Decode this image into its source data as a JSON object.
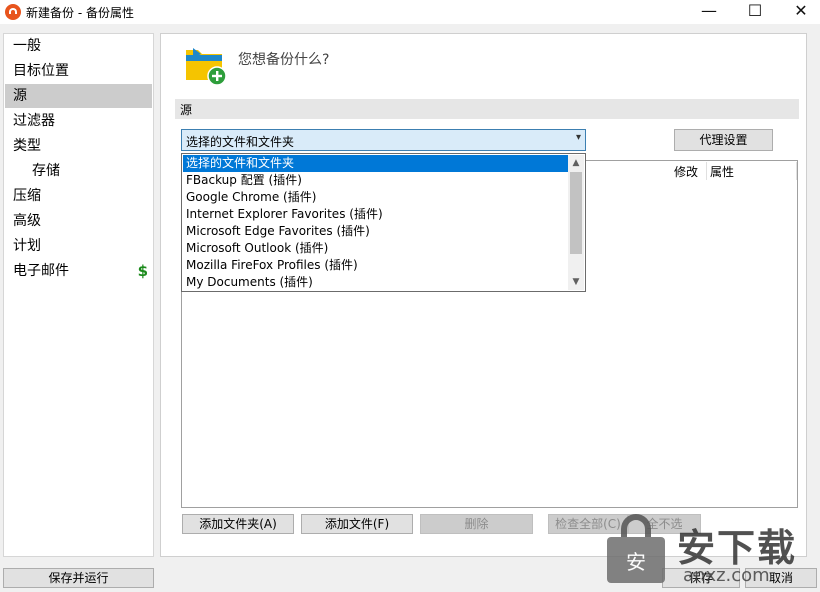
{
  "window": {
    "title": "新建备份 - 备份属性",
    "minimize_glyph": "—",
    "maximize_glyph": "☐",
    "close_glyph": "✕"
  },
  "sidebar": {
    "items": [
      {
        "label": "一般"
      },
      {
        "label": "目标位置"
      },
      {
        "label": "源",
        "selected": true
      },
      {
        "label": "过滤器"
      },
      {
        "label": "类型"
      },
      {
        "label": "存储",
        "sub": true
      },
      {
        "label": "压缩"
      },
      {
        "label": "高级"
      },
      {
        "label": "计划"
      },
      {
        "label": "电子邮件",
        "badge": "$"
      }
    ]
  },
  "main": {
    "question": "您想备份什么?",
    "section_title": "源",
    "source_select": {
      "value": "选择的文件和文件夹",
      "options": [
        "选择的文件和文件夹",
        "FBackup 配置 (插件)",
        "Google Chrome (插件)",
        "Internet Explorer Favorites (插件)",
        "Microsoft Edge Favorites (插件)",
        "Microsoft Outlook (插件)",
        "Mozilla FireFox Profiles (插件)",
        "My Documents (插件)"
      ]
    },
    "proxy_button": "代理设置",
    "columns": [
      "修改",
      "属性"
    ],
    "buttons": {
      "add_folder": "添加文件夹(A)",
      "add_file": "添加文件(F)",
      "delete": "删除",
      "check_all": "检查全部(C)",
      "uncheck_all": "全不选"
    }
  },
  "footer": {
    "save_run": "保存并运行",
    "save": "保存",
    "cancel": "取消"
  },
  "watermark": {
    "text": "安下载",
    "sub": "anxz.com"
  },
  "colors": {
    "selection": "#0078d7",
    "select_bg": "#d9ebf9",
    "accent_green": "#1b8a1b",
    "app_icon": "#e8541d"
  }
}
